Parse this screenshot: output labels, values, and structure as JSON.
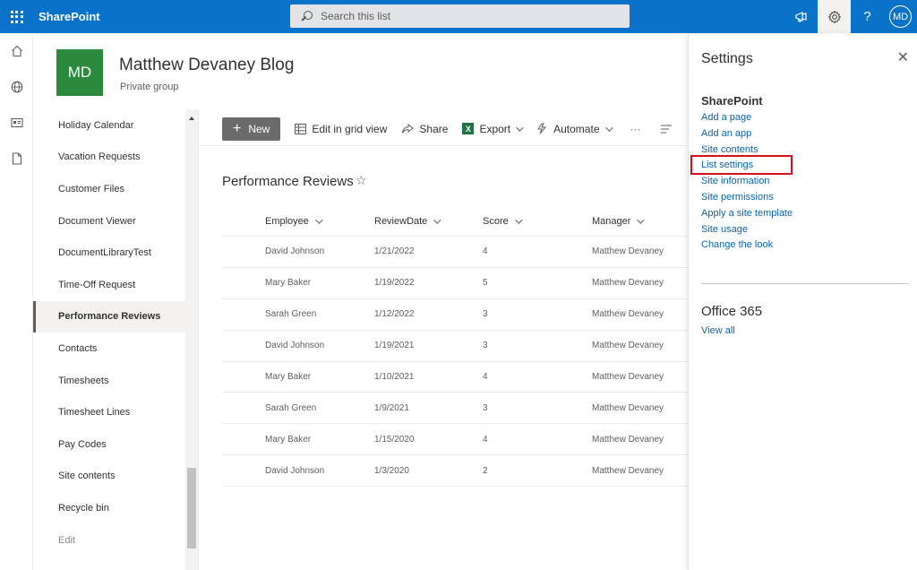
{
  "suitebar": {
    "brand": "SharePoint",
    "search_placeholder": "Search this list",
    "avatar_initials": "MD"
  },
  "site": {
    "logo_initials": "MD",
    "title": "Matthew Devaney Blog",
    "subtitle": "Private group"
  },
  "leftnav": {
    "items": [
      {
        "label": "Holiday Calendar"
      },
      {
        "label": "Vacation Requests"
      },
      {
        "label": "Customer Files"
      },
      {
        "label": "Document Viewer"
      },
      {
        "label": "DocumentLibraryTest"
      },
      {
        "label": "Time-Off Request"
      },
      {
        "label": "Performance Reviews"
      },
      {
        "label": "Contacts"
      },
      {
        "label": "Timesheets"
      },
      {
        "label": "Timesheet Lines"
      },
      {
        "label": "Pay Codes"
      },
      {
        "label": "Site contents"
      },
      {
        "label": "Recycle bin"
      },
      {
        "label": "Edit"
      }
    ],
    "selected": "Performance Reviews"
  },
  "commandbar": {
    "new_label": "New",
    "grid_label": "Edit in grid view",
    "share_label": "Share",
    "export_label": "Export",
    "automate_label": "Automate",
    "more_label": "···"
  },
  "list": {
    "title": "Performance Reviews",
    "star": "☆",
    "columns": [
      "Employee",
      "ReviewDate",
      "Score",
      "Manager"
    ],
    "rows": [
      [
        "David Johnson",
        "1/21/2022",
        "4",
        "Matthew Devaney"
      ],
      [
        "Mary Baker",
        "1/19/2022",
        "5",
        "Matthew Devaney"
      ],
      [
        "Sarah Green",
        "1/12/2022",
        "3",
        "Matthew Devaney"
      ],
      [
        "David Johnson",
        "1/19/2021",
        "3",
        "Matthew Devaney"
      ],
      [
        "Mary Baker",
        "1/10/2021",
        "4",
        "Matthew Devaney"
      ],
      [
        "Sarah Green",
        "1/9/2021",
        "3",
        "Matthew Devaney"
      ],
      [
        "Mary Baker",
        "1/15/2020",
        "4",
        "Matthew Devaney"
      ],
      [
        "David Johnson",
        "1/3/2020",
        "2",
        "Matthew Devaney"
      ]
    ]
  },
  "settings": {
    "title": "Settings",
    "close": "✕",
    "sharepoint_heading": "SharePoint",
    "links": [
      "Add a page",
      "Add an app",
      "Site contents",
      "List settings",
      "Site information",
      "Site permissions",
      "Apply a site template",
      "Site usage",
      "Change the look"
    ],
    "office_heading": "Office 365",
    "view_all": "View all",
    "highlight_color": "#d1111b"
  }
}
